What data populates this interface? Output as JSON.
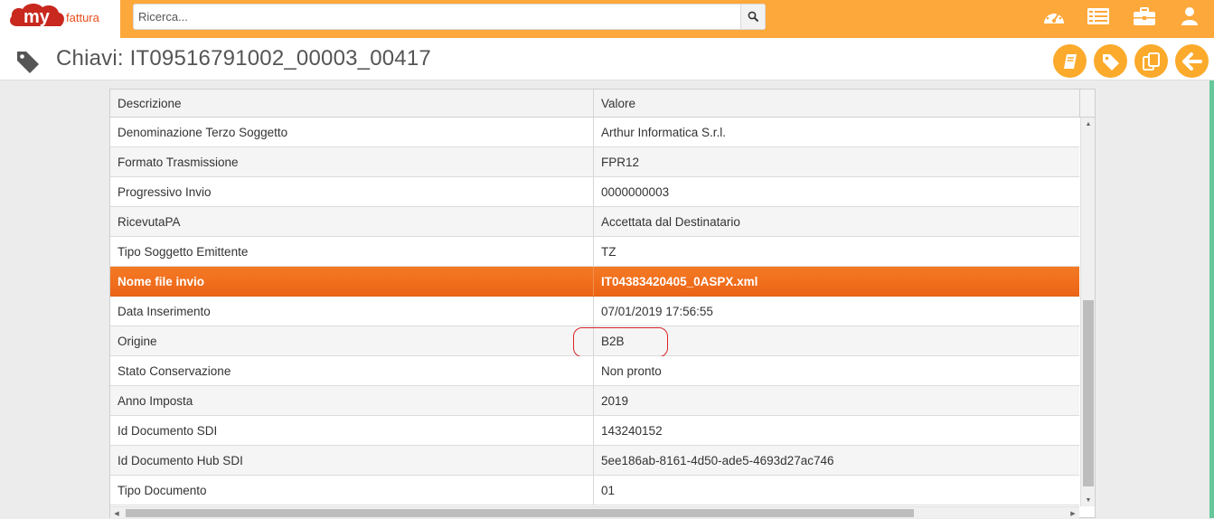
{
  "app": {
    "logo_main": "my",
    "logo_sub": "fattura"
  },
  "search": {
    "placeholder": "Ricerca..."
  },
  "top_icons": [
    "dashboard-icon",
    "list-icon",
    "briefcase-icon",
    "user-icon"
  ],
  "page": {
    "title": "Chiavi: IT09516791002_00003_00417"
  },
  "action_buttons": [
    "book-icon",
    "tag-icon",
    "copy-icon",
    "back-arrow-icon"
  ],
  "table": {
    "headers": {
      "description": "Descrizione",
      "value": "Valore"
    },
    "rows": [
      {
        "description": "Denominazione Terzo Soggetto",
        "value": "Arthur Informatica S.r.l."
      },
      {
        "description": "Formato Trasmissione",
        "value": "FPR12"
      },
      {
        "description": "Progressivo Invio",
        "value": "0000000003"
      },
      {
        "description": "RicevutaPA",
        "value": "Accettata dal Destinatario"
      },
      {
        "description": "Tipo Soggetto Emittente",
        "value": "TZ"
      },
      {
        "description": "Nome file invio",
        "value": "IT04383420405_0ASPX.xml"
      },
      {
        "description": "Data Inserimento",
        "value": "07/01/2019 17:56:55"
      },
      {
        "description": "Origine",
        "value": "B2B"
      },
      {
        "description": "Stato Conservazione",
        "value": "Non pronto"
      },
      {
        "description": "Anno Imposta",
        "value": "2019"
      },
      {
        "description": "Id Documento SDI",
        "value": "143240152"
      },
      {
        "description": "Id Documento Hub SDI",
        "value": "5ee186ab-8161-4d50-ade5-4693d27ac746"
      },
      {
        "description": "Tipo Documento",
        "value": "01"
      }
    ],
    "selected_row": 5,
    "highlighted_row": 7
  },
  "colors": {
    "accent": "#fda83a",
    "selected": "#ef6b1c",
    "ring": "#d9252a",
    "brand": "#e84e1b"
  }
}
